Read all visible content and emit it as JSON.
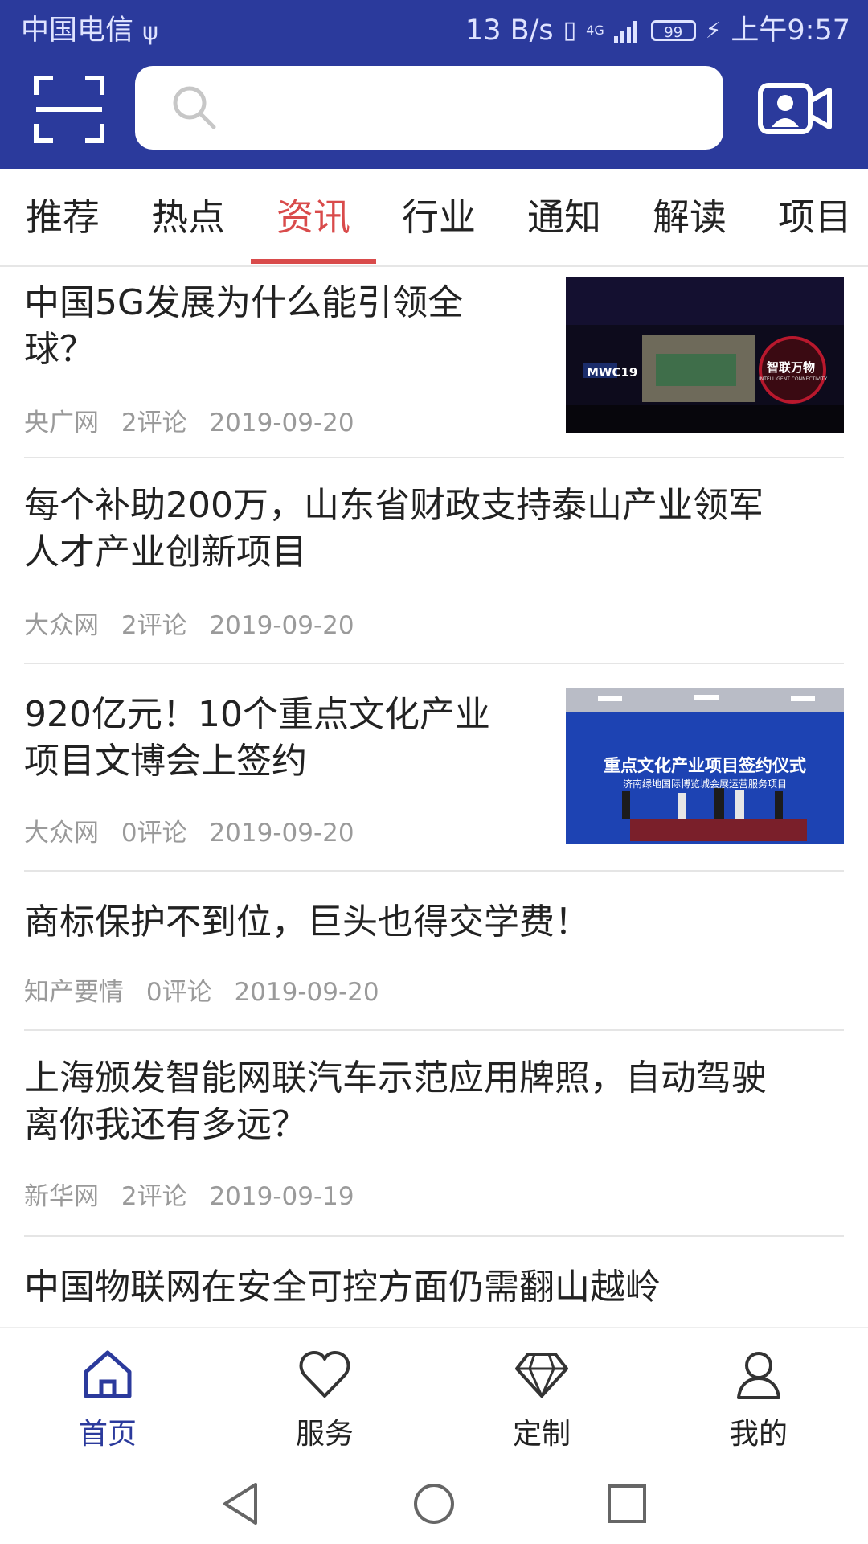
{
  "status_bar": {
    "carrier": "中国电信",
    "network_speed": "13 B/s",
    "signal_label": "4G",
    "battery": "99",
    "time": "上午9:57"
  },
  "header": {
    "search_placeholder": "",
    "scan_icon": "scan-icon",
    "camera_icon": "video-camera-icon",
    "brand_color": "#2b3a9c"
  },
  "tabs": [
    {
      "label": "推荐"
    },
    {
      "label": "热点"
    },
    {
      "label": "资讯"
    },
    {
      "label": "行业"
    },
    {
      "label": "通知"
    },
    {
      "label": "解读"
    },
    {
      "label": "项目"
    }
  ],
  "active_tab": "资讯",
  "accent_color": "#d94b4b",
  "articles": [
    {
      "title_line1": "中国5G发展为什么能引领全",
      "title_line2": "球？",
      "source": "央广网",
      "comments": "2评论",
      "date": "2019-09-20",
      "thumb_text_1": "MWC19",
      "thumb_text_2": "智联万物",
      "thumb_text_3": "INTELLIGENT CONNECTIVITY"
    },
    {
      "title_line1": "每个补助200万，山东省财政支持泰山产业领军",
      "title_line2": "人才产业创新项目",
      "source": "大众网",
      "comments": "2评论",
      "date": "2019-09-20"
    },
    {
      "title_line1": "920亿元！10个重点文化产业",
      "title_line2": "项目文博会上签约",
      "source": "大众网",
      "comments": "0评论",
      "date": "2019-09-20",
      "thumb_text_1": "重点文化产业项目签约仪式",
      "thumb_text_2": "济南绿地国际博览城会展运营服务项目"
    },
    {
      "title_line1": "商标保护不到位，巨头也得交学费！",
      "title_line2": "",
      "source": "知产要情",
      "comments": "0评论",
      "date": "2019-09-20"
    },
    {
      "title_line1": "上海颁发智能网联汽车示范应用牌照，自动驾驶",
      "title_line2": "离你我还有多远？",
      "source": "新华网",
      "comments": "2评论",
      "date": "2019-09-19"
    },
    {
      "title_line1": "中国物联网在安全可控方面仍需翻山越岭",
      "title_line2": "",
      "source": "",
      "comments": "",
      "date": ""
    }
  ],
  "bottom_nav": [
    {
      "label": "首页",
      "icon": "home-icon"
    },
    {
      "label": "服务",
      "icon": "heart-icon"
    },
    {
      "label": "定制",
      "icon": "diamond-icon"
    },
    {
      "label": "我的",
      "icon": "user-icon"
    }
  ],
  "active_nav": "首页"
}
